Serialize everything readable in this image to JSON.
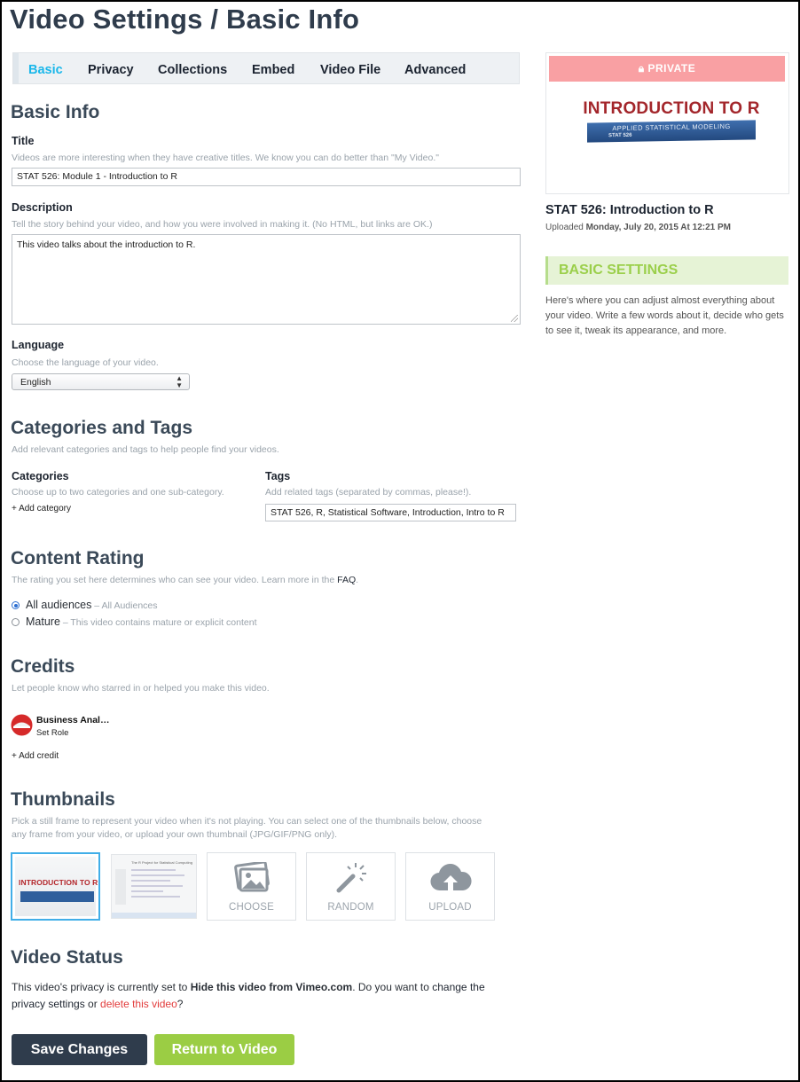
{
  "page": {
    "title": "Video Settings / Basic Info"
  },
  "tabs": [
    "Basic",
    "Privacy",
    "Collections",
    "Embed",
    "Video File",
    "Advanced"
  ],
  "basic_info": {
    "heading": "Basic Info",
    "title_label": "Title",
    "title_hint": "Videos are more interesting when they have creative titles. We know you can do better than \"My Video.\"",
    "title_value": "STAT 526: Module 1 - Introduction to R",
    "description_label": "Description",
    "description_hint": "Tell the story behind your video, and how you were involved in making it. (No HTML, but links are OK.)",
    "description_value": "This video talks about the introduction to R.",
    "language_label": "Language",
    "language_hint": "Choose the language of your video.",
    "language_value": "English"
  },
  "categories_tags": {
    "heading": "Categories and Tags",
    "hint": "Add relevant categories and tags to help people find your videos.",
    "categories_label": "Categories",
    "categories_hint": "Choose up to two categories and one sub-category.",
    "add_category": "+ Add category",
    "tags_label": "Tags",
    "tags_hint": "Add related tags (separated by commas, please!).",
    "tags_value": "STAT 526, R, Statistical Software, Introduction, Intro to R"
  },
  "content_rating": {
    "heading": "Content Rating",
    "hint_prefix": "The rating you set here determines who can see your video. Learn more in the ",
    "hint_link": "FAQ",
    "hint_suffix": ".",
    "options": [
      {
        "label": "All audiences",
        "sub": " – All Audiences",
        "selected": true
      },
      {
        "label": "Mature",
        "sub": " – This video contains mature or explicit content",
        "selected": false
      }
    ]
  },
  "credits": {
    "heading": "Credits",
    "hint": "Let people know who starred in or helped you make this video.",
    "person_name": "Business Anal…",
    "person_role": "Set Role",
    "add_credit": "+ Add credit"
  },
  "thumbnails": {
    "heading": "Thumbnails",
    "hint_line1": "Pick a still frame to represent your video when it's not playing. You can select one of the thumbnails below, choose",
    "hint_line2": "any frame from your video, or upload your own thumbnail (JPG/GIF/PNG only).",
    "thumb1_text": "INTRODUCTION TO R",
    "thumb2_text": "The R Project for Statistical Computing",
    "choose": "CHOOSE",
    "random": "RANDOM",
    "upload": "UPLOAD"
  },
  "video_status": {
    "heading": "Video Status",
    "text1": "This video's privacy is currently set to ",
    "privacy_setting": "Hide this video from Vimeo.com",
    "text2": ". Do you want to ",
    "change_link_1": "change the",
    "change_link_2": "privacy settings",
    "text3": " or ",
    "delete_link": "delete this video",
    "text4": "?"
  },
  "buttons": {
    "save": "Save Changes",
    "return": "Return to Video"
  },
  "sidebar": {
    "private_badge": "PRIVATE",
    "preview_title": "INTRODUCTION TO R",
    "preview_subtitle": "APPLIED STATISTICAL MODELING",
    "preview_course": "STAT 526",
    "video_title": "STAT 526: Introduction to R",
    "uploaded_prefix": "Uploaded ",
    "uploaded_date": "Monday, July 20, 2015 At 12:21 PM",
    "basic_settings_heading": "BASIC SETTINGS",
    "basic_settings_desc": "Here's where you can adjust almost everything about your video. Write a few words about it, decide who gets to see it, tweak its appearance, and more."
  },
  "colors": {
    "accent_blue": "#1ab7ea",
    "save_button": "#2f3c4c",
    "return_button": "#9bcd44",
    "private_badge": "#f9a0a3",
    "basic_settings_text": "#9bcf4b",
    "delete_link": "#e23b3b"
  }
}
